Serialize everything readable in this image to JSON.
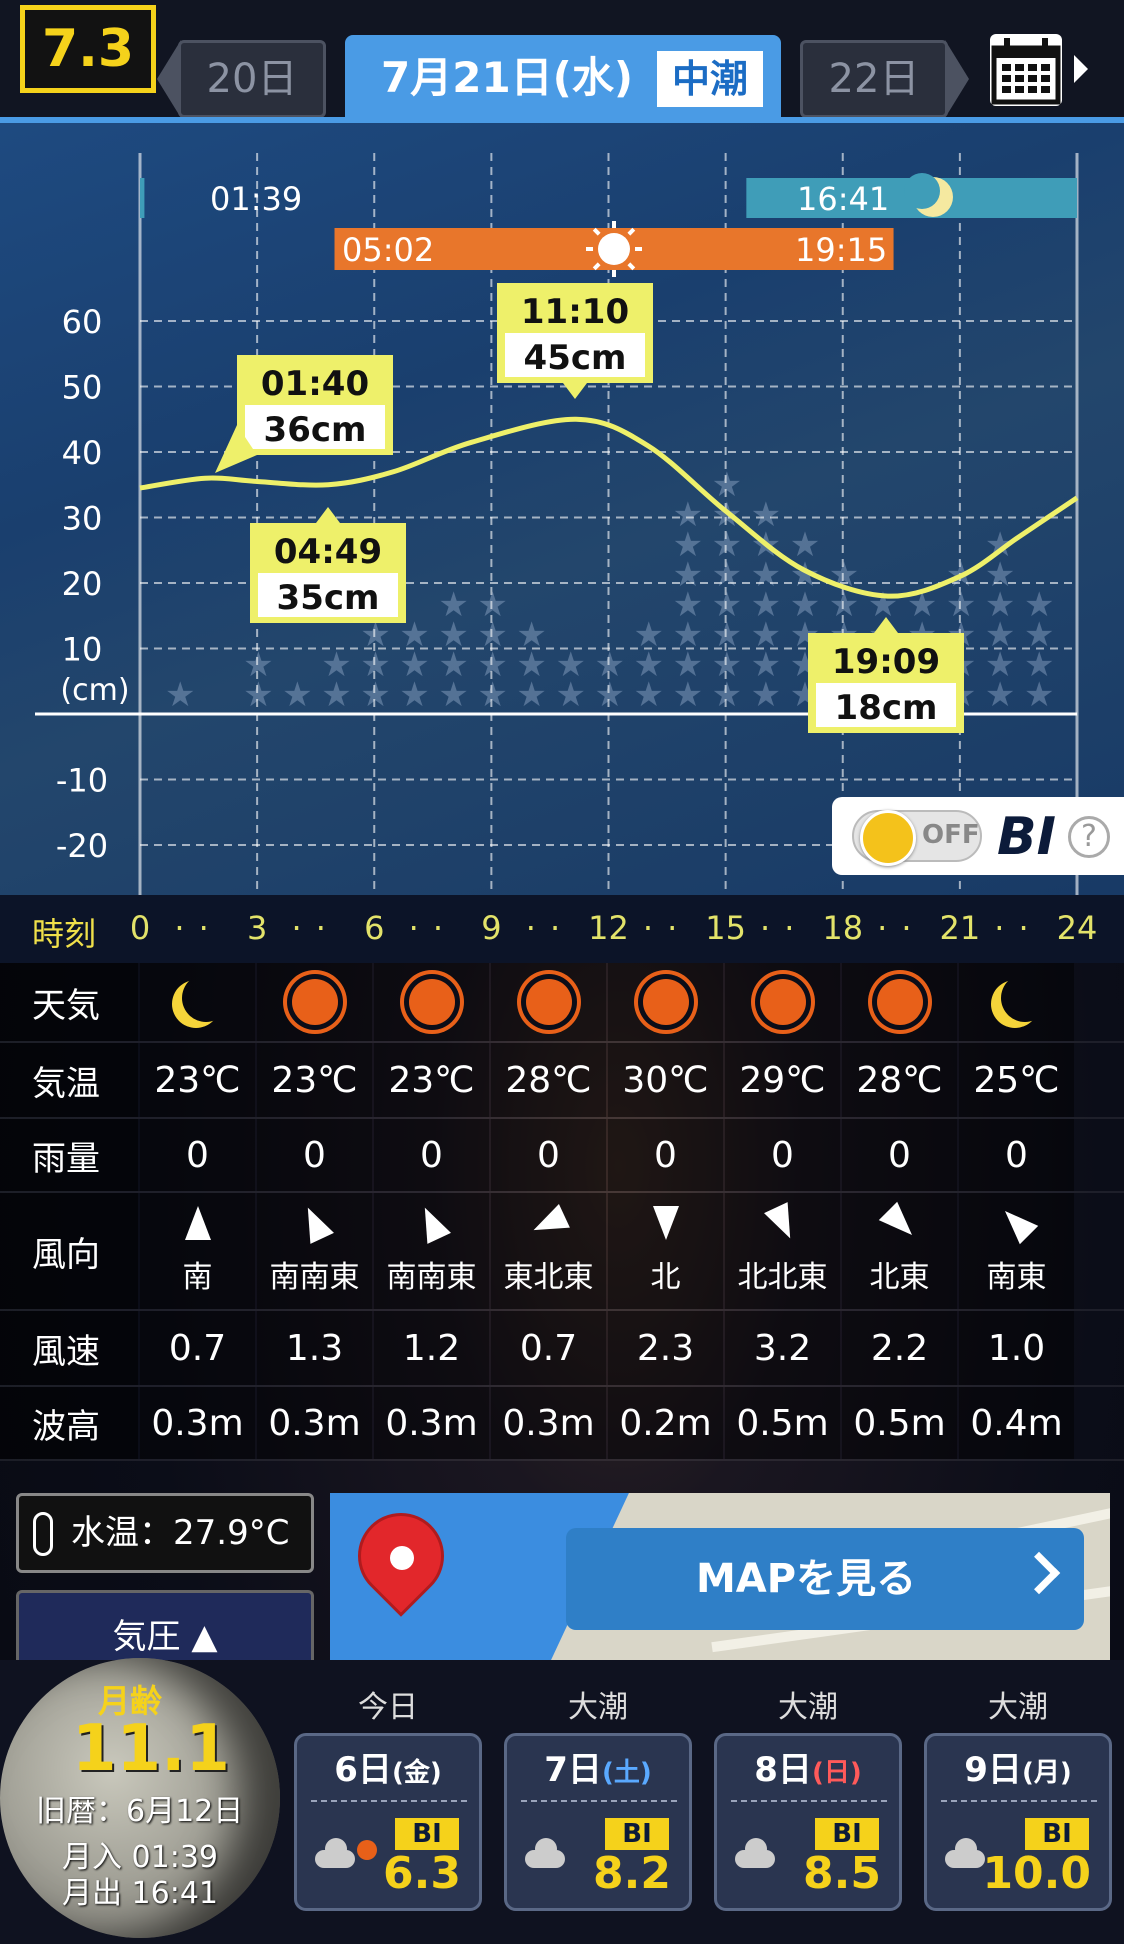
{
  "header": {
    "tide_index": "7.3",
    "prev_day": "20日",
    "date": "7月21日(水)",
    "tide_name": "中潮",
    "next_day": "22日"
  },
  "chart": {
    "moonset_time": "01:39",
    "moonrise_time": "16:41",
    "sunrise_time": "05:02",
    "sunset_time": "19:15",
    "y_unit": "(cm)",
    "y_ticks": [
      "60",
      "50",
      "40",
      "30",
      "20",
      "10",
      "-10",
      "-20"
    ],
    "x_label": "時刻",
    "x_ticks": [
      "0",
      "3",
      "6",
      "9",
      "12",
      "15",
      "18",
      "21",
      "24"
    ]
  },
  "chart_data": {
    "type": "line",
    "xlabel": "時刻",
    "ylabel": "(cm)",
    "xlim": [
      0,
      24
    ],
    "ylim": [
      -20,
      60
    ],
    "series": [
      {
        "x": [
          0,
          1.67,
          3.0,
          4.82,
          6.5,
          8.5,
          11.17,
          13.0,
          15.0,
          17.0,
          19.15,
          21.0,
          22.5,
          24.0
        ],
        "values": [
          34.5,
          36,
          35.5,
          35,
          37,
          41.5,
          45,
          41,
          31,
          22,
          18,
          21,
          27,
          33
        ]
      }
    ],
    "annotations": [
      {
        "time": "01:40",
        "height": "36cm"
      },
      {
        "time": "04:49",
        "height": "35cm"
      },
      {
        "time": "11:10",
        "height": "45cm"
      },
      {
        "time": "19:09",
        "height": "18cm"
      }
    ]
  },
  "bi_toggle": {
    "state": "OFF",
    "label": "BI",
    "help": "?"
  },
  "weather": {
    "labels": {
      "weather": "天気",
      "temp": "気温",
      "rain": "雨量",
      "wind_dir": "風向",
      "wind_speed": "風速",
      "wave": "波高"
    },
    "columns": [
      {
        "icon": "moon-icon",
        "temp": "23℃",
        "rain": "0",
        "dir": "南",
        "speed": "0.7",
        "wave": "0.3m",
        "rot": 0
      },
      {
        "icon": "sun-icon",
        "temp": "23℃",
        "rain": "0",
        "dir": "南南東",
        "speed": "1.3",
        "wave": "0.3m",
        "rot": -25
      },
      {
        "icon": "sun-icon",
        "temp": "23℃",
        "rain": "0",
        "dir": "南南東",
        "speed": "1.2",
        "wave": "0.3m",
        "rot": -25
      },
      {
        "icon": "sun-icon",
        "temp": "28℃",
        "rain": "0",
        "dir": "東北東",
        "speed": "0.7",
        "wave": "0.3m",
        "rot": -115
      },
      {
        "icon": "sun-icon",
        "temp": "30℃",
        "rain": "0",
        "dir": "北",
        "speed": "2.3",
        "wave": "0.2m",
        "rot": 180
      },
      {
        "icon": "sun-icon",
        "temp": "29℃",
        "rain": "0",
        "dir": "北北東",
        "speed": "3.2",
        "wave": "0.5m",
        "rot": 155
      },
      {
        "icon": "sun-icon",
        "temp": "28℃",
        "rain": "0",
        "dir": "北東",
        "speed": "2.2",
        "wave": "0.5m",
        "rot": 135
      },
      {
        "icon": "moon-icon",
        "temp": "25℃",
        "rain": "0",
        "dir": "南東",
        "speed": "1.0",
        "wave": "0.4m",
        "rot": -45
      }
    ]
  },
  "water_temp": "水温：27.9°C",
  "pressure_label": "気圧 ▲",
  "map_button": "MAPを見る",
  "moon": {
    "age_label": "月齢",
    "age_value": "11.1",
    "lunar_date": "旧暦：6月12日",
    "moonset": "月入 01:39",
    "moonrise": "月出 16:41"
  },
  "days": [
    {
      "label": "今日",
      "date": "6日",
      "dow": "(金)",
      "dow_color": "#ffffff",
      "bi": "BI",
      "value": "6.3",
      "sun": true
    },
    {
      "label": "大潮",
      "date": "7日",
      "dow": "(土)",
      "dow_color": "#5aa9ff",
      "bi": "BI",
      "value": "8.2",
      "sun": false
    },
    {
      "label": "大潮",
      "date": "8日",
      "dow": "(日)",
      "dow_color": "#ff5a5a",
      "bi": "BI",
      "value": "8.5",
      "sun": false
    },
    {
      "label": "大潮",
      "date": "9日",
      "dow": "(月)",
      "dow_color": "#ffffff",
      "bi": "BI",
      "value": "10.0",
      "sun": false
    }
  ]
}
